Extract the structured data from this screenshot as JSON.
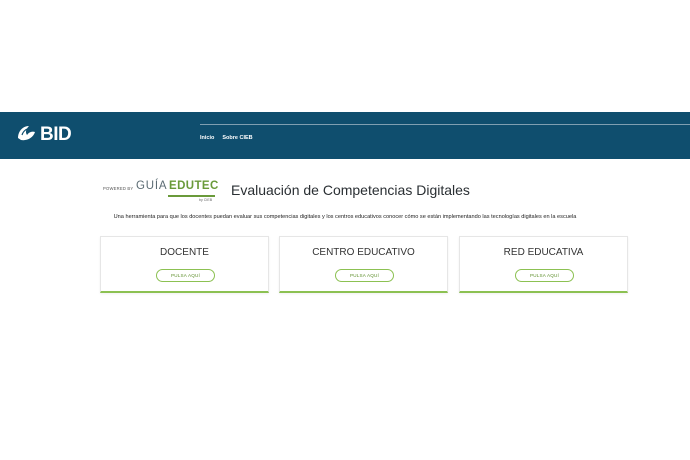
{
  "header": {
    "logo_text": "BID",
    "nav": [
      {
        "label": "Inicio"
      },
      {
        "label": "Sobre CIEB"
      }
    ]
  },
  "brand": {
    "powered_by": "POWERED BY",
    "guia": "GUÍA",
    "edutec": "EDUTEC",
    "by_cieb": "by CIEB",
    "accent_color": "#8cc152"
  },
  "main": {
    "title": "Evaluación de Competencias Digitales",
    "subtitle": "Una herramienta para que los docentes puedan evaluar sus competencias digitales y los centros educativos conocer cómo se están implementando las tecnologías digitales en la escuela",
    "cards": [
      {
        "title": "DOCENTE",
        "button": "PULSA AQUÍ"
      },
      {
        "title": "CENTRO EDUCATIVO",
        "button": "PULSA AQUÍ"
      },
      {
        "title": "RED EDUCATIVA",
        "button": "PULSA AQUÍ"
      }
    ]
  },
  "colors": {
    "header_bg": "#0f4e6e"
  }
}
